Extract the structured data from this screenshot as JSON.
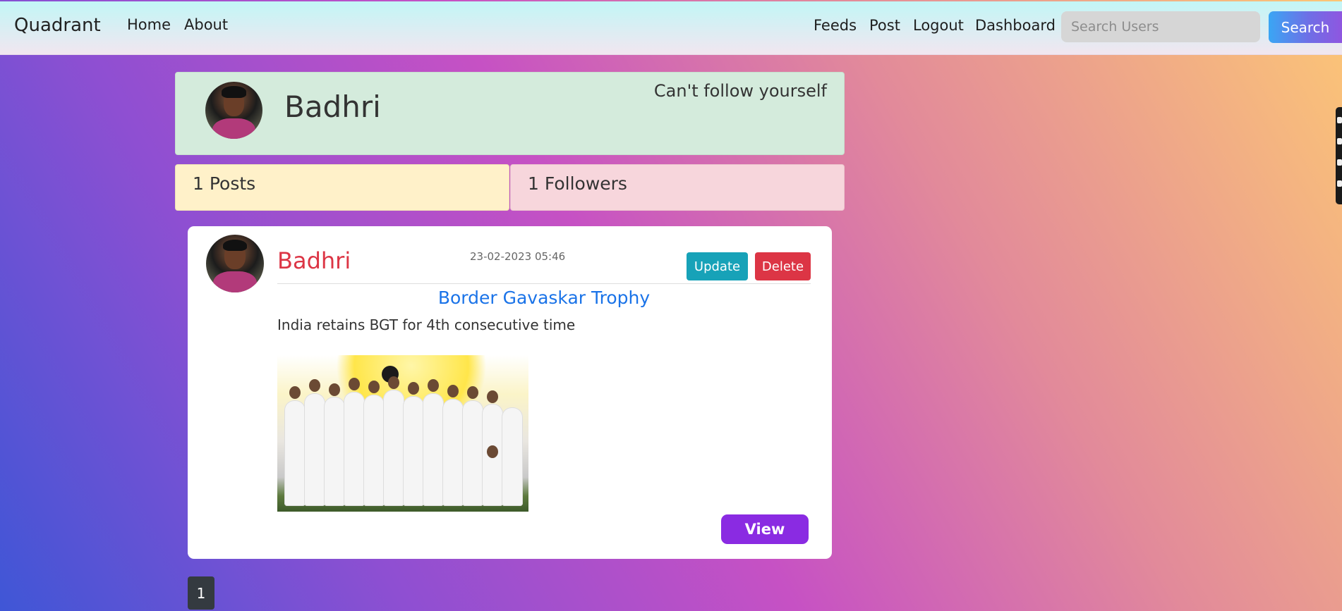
{
  "navbar": {
    "brand": "Quadrant",
    "left_links": [
      "Home",
      "About"
    ],
    "right_links": [
      "Feeds",
      "Post",
      "Logout",
      "Dashboard"
    ],
    "search_placeholder": "Search Users",
    "search_button": "Search"
  },
  "profile": {
    "name": "Badhri",
    "follow_note": "Can't follow yourself",
    "posts_count": "1 Posts",
    "followers_count": "1 Followers"
  },
  "post": {
    "author": "Badhri",
    "timestamp": "23-02-2023 05:46",
    "update_label": "Update",
    "delete_label": "Delete",
    "title": "Border Gavaskar Trophy",
    "body": "India retains BGT for 4th consecutive time",
    "view_label": "View"
  },
  "pagination": {
    "current_page": "1"
  },
  "colors": {
    "brand_danger": "#dc3545",
    "info": "#17a2b8",
    "view_purple": "#8a2be2",
    "link_blue": "#1a73e8"
  }
}
